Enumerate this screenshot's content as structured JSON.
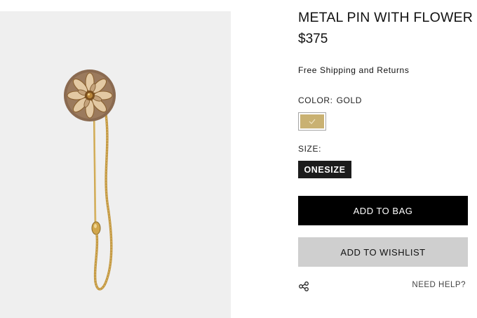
{
  "product": {
    "image_alt": "Metal pin with flower brooch",
    "title": "METAL PIN WITH FLOWER",
    "price": "$375",
    "shipping_note": "Free Shipping and Returns"
  },
  "color": {
    "label": "COLOR:",
    "selected": "GOLD",
    "swatch_hex": "#c9b172",
    "swatch_icon": "checkmark-icon"
  },
  "size": {
    "label": "SIZE:",
    "options": [
      "ONESIZE"
    ]
  },
  "actions": {
    "add_to_bag": "ADD TO BAG",
    "add_to_wishlist": "ADD TO WISHLIST",
    "share_icon": "share-icon",
    "need_help": "NEED HELP?"
  },
  "colors": {
    "primary_button": "#000000",
    "secondary_button": "#cfcfcf",
    "chip": "#1c1c1c",
    "image_background": "#efefef"
  }
}
